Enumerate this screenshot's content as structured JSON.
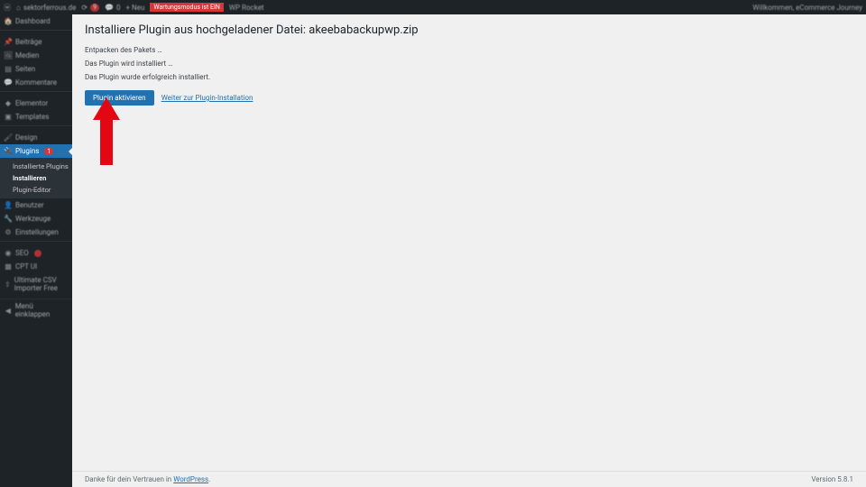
{
  "adminbar": {
    "site_name": "sektorferrous.de",
    "comments_count": "0",
    "plus_label": "+ Neu",
    "updates_count": "9",
    "wp_rocket_pre": "Wartungsmodus ist EIN",
    "wp_rocket": "WP Rocket",
    "welcome": "Willkommen, eCommerce Journey"
  },
  "sidebar": {
    "dashboard": "Dashboard",
    "posts": "Beiträge",
    "media": "Medien",
    "pages": "Seiten",
    "comments": "Kommentare",
    "elementor": "Elementor",
    "templates": "Templates",
    "design": "Design",
    "plugins": "Plugins",
    "plugins_badge": "1",
    "plugins_sub": {
      "installed": "Installierte Plugins",
      "install": "Installieren",
      "editor": "Plugin-Editor"
    },
    "users": "Benutzer",
    "tools": "Werkzeuge",
    "settings": "Einstellungen",
    "seo": "SEO",
    "cpt": "CPT UI",
    "extra": "Ultimate CSV Importer Free",
    "collapse": "Menü einklappen"
  },
  "content": {
    "heading": "Installiere Plugin aus hochgeladener Datei: akeebabackupwp.zip",
    "line1": "Entpacken des Pakets …",
    "line2": "Das Plugin wird installiert …",
    "line3": "Das Plugin wurde erfolgreich installiert.",
    "btn_activate": "Plugin aktivieren",
    "link_back": "Weiter zur Plugin-Installation"
  },
  "footer": {
    "thanks_pre": "Danke für dein Vertrauen in ",
    "wp": "WordPress",
    "period": ".",
    "version": "Version 5.8.1"
  }
}
